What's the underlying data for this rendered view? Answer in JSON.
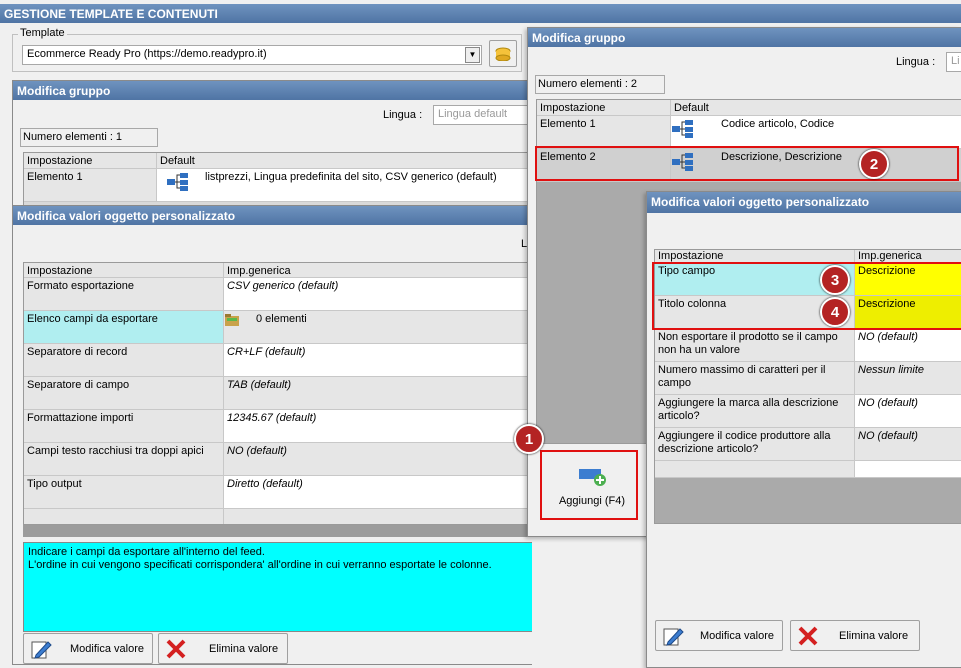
{
  "app": {
    "title": "GESTIONE TEMPLATE E CONTENUTI"
  },
  "template": {
    "label": "Template",
    "value": "Ecommerce Ready Pro (https://demo.readypro.it)"
  },
  "group_left": {
    "title": "Modifica gruppo",
    "lingua_label": "Lingua :",
    "lingua_placeholder": "Lingua default",
    "count": "Numero elementi : 1",
    "headers": [
      "Impostazione",
      "Default"
    ],
    "rows": [
      {
        "name": "Elemento 1",
        "value": "listprezzi, Lingua predefinita del sito, CSV generico (default)"
      }
    ]
  },
  "obj_left": {
    "title": "Modifica valori oggetto personalizzato",
    "lingua_fragment": "L",
    "headers": [
      "Impostazione",
      "Imp.generica"
    ],
    "rows": [
      {
        "name": "Formato esportazione",
        "value": "CSV generico (default)"
      },
      {
        "name": "Elenco campi da esportare",
        "value": "0 elementi"
      },
      {
        "name": "Separatore di record",
        "value": "CR+LF (default)"
      },
      {
        "name": "Separatore di campo",
        "value": "TAB (default)"
      },
      {
        "name": "Formattazione importi",
        "value": "12345.67 (default)"
      },
      {
        "name": "Campi testo racchiusi tra doppi apici",
        "value": "NO (default)"
      },
      {
        "name": "Tipo output",
        "value": "Diretto (default)"
      }
    ],
    "help_line1": "Indicare i campi da esportare all'interno del feed.",
    "help_line2": "L'ordine in cui vengono specificati corrispondera' all'ordine in cui verranno esportate le colonne.",
    "edit_button": "Modifica valore",
    "delete_button": "Elimina valore"
  },
  "group_right": {
    "title": "Modifica gruppo",
    "lingua_label": "Lingua :",
    "lingua_fragment": "Li",
    "count": "Numero elementi : 2",
    "headers": [
      "Impostazione",
      "Default"
    ],
    "rows": [
      {
        "name": "Elemento 1",
        "value": "Codice articolo, Codice"
      },
      {
        "name": "Elemento 2",
        "value": "Descrizione, Descrizione"
      }
    ],
    "add_button": "Aggiungi (F4)"
  },
  "obj_right": {
    "title": "Modifica valori oggetto personalizzato",
    "headers": [
      "Impostazione",
      "Imp.generica"
    ],
    "rows": [
      {
        "name": "Tipo campo",
        "value": "Descrizione"
      },
      {
        "name": "Titolo colonna",
        "value": "Descrizione"
      },
      {
        "name": "Non esportare il prodotto se il campo non ha un valore",
        "value": "NO (default)"
      },
      {
        "name": "Numero massimo di caratteri per il campo",
        "value": "Nessun limite"
      },
      {
        "name": "Aggiungere la marca alla descrizione articolo?",
        "value": "NO (default)"
      },
      {
        "name": "Aggiungere il codice produttore alla descrizione articolo?",
        "value": "NO (default)"
      }
    ],
    "edit_button": "Modifica valore",
    "delete_button": "Elimina valore"
  },
  "badges": [
    "1",
    "2",
    "3",
    "4"
  ],
  "colors": {
    "title_bar": "#5a7fae",
    "cyan": "#00ffff",
    "light_cyan": "#b0eef0",
    "yellow": "#ffff00",
    "highlight_red": "#e01010"
  }
}
